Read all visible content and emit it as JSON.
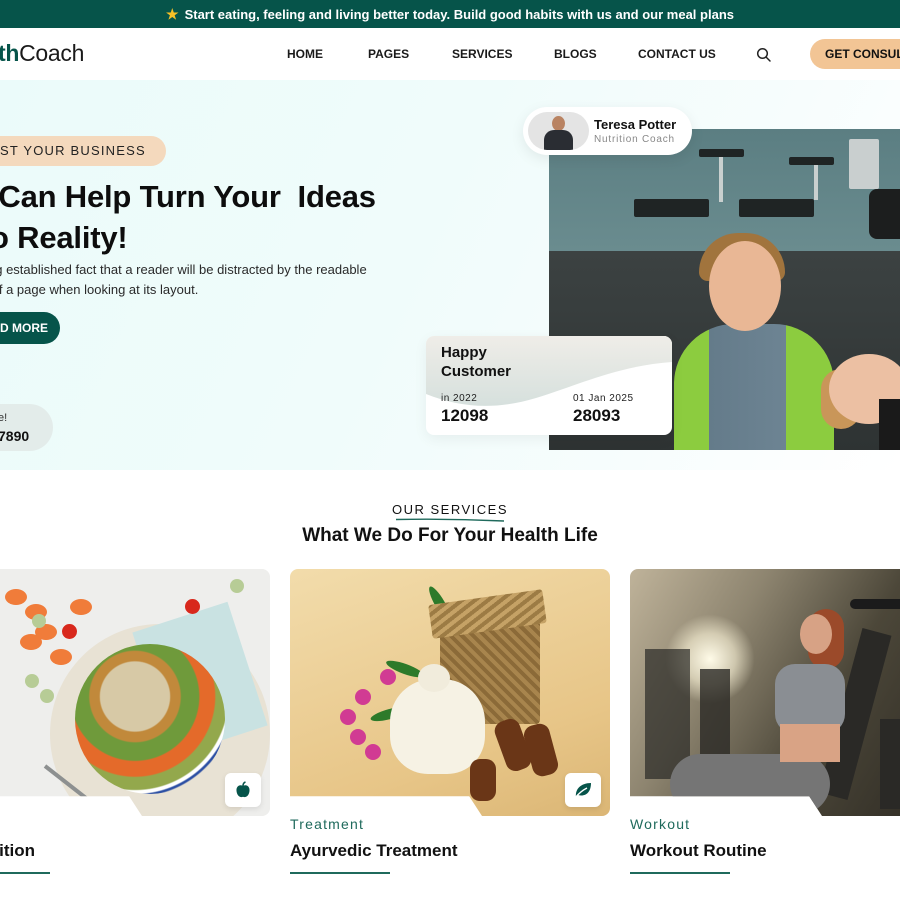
{
  "announcement": {
    "icon": "star-icon",
    "text": "Start eating, feeling and living better today. Build good habits with us and our meal plans"
  },
  "header": {
    "logo_accent": "th",
    "logo_rest": "Coach",
    "nav": [
      "HOME",
      "PAGES",
      "SERVICES",
      "BLOGS",
      "CONTACT US"
    ],
    "search_icon": "search-icon",
    "cta_label": "GET CONSULT"
  },
  "hero": {
    "tag": "ST YOUR BUSINESS",
    "headline_line1": " Can Help Turn Your  Ideas",
    "headline_line2": "o Reality!",
    "lead_line1": "ng established fact that a reader will be distracted by the readable",
    "lead_line2": " of a page when looking at its layout.",
    "read_more_label": "D MORE",
    "call_line1": "e!",
    "call_line2": "7890",
    "coach": {
      "name": "Teresa Potter",
      "role": "Nutrition Coach"
    },
    "stats": {
      "title": "Happy Customer",
      "items": [
        {
          "label": "in 2022",
          "value": "12098"
        },
        {
          "label": "01 Jan 2025",
          "value": "28093"
        }
      ]
    }
  },
  "services": {
    "eyebrow": "OUR SERVICES",
    "title": "What We Do For Your Health Life",
    "accent_color": "#1f6a5c",
    "cards": [
      {
        "category": "",
        "title": "s Nutrition",
        "icon": "apple-icon"
      },
      {
        "category": "Treatment",
        "title": "Ayurvedic Treatment",
        "icon": "leaf-icon"
      },
      {
        "category": "Workout",
        "title": "Workout Routine",
        "icon": ""
      }
    ]
  },
  "colors": {
    "brand_green": "#06544a",
    "accent_peach": "#f2c595",
    "tag_peach": "#f4d9bd"
  }
}
